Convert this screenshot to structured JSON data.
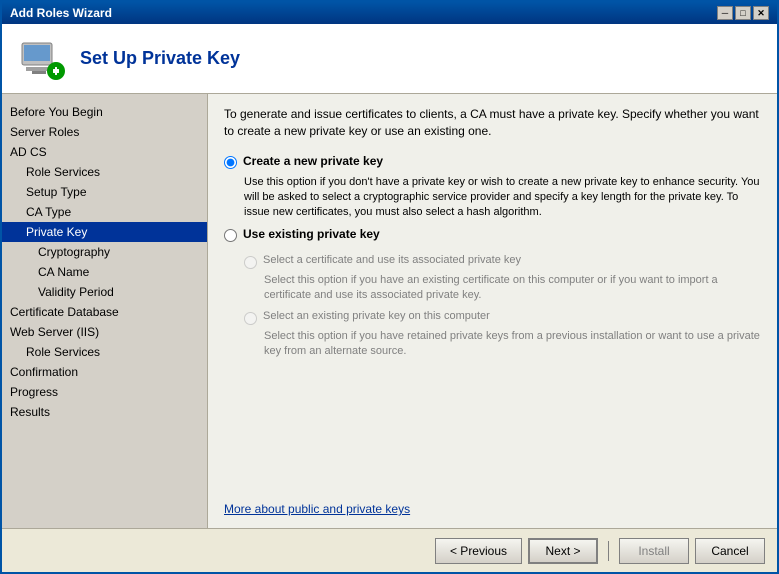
{
  "window": {
    "title": "Add Roles Wizard",
    "close_btn": "✕",
    "minimize_btn": "─",
    "maximize_btn": "□"
  },
  "header": {
    "title": "Set Up Private Key",
    "icon_alt": "wizard-icon"
  },
  "sidebar": {
    "items": [
      {
        "label": "Before You Begin",
        "level": "section",
        "state": "normal"
      },
      {
        "label": "Server Roles",
        "level": "section",
        "state": "normal"
      },
      {
        "label": "AD CS",
        "level": "section",
        "state": "normal"
      },
      {
        "label": "Role Services",
        "level": "sub",
        "state": "normal"
      },
      {
        "label": "Setup Type",
        "level": "sub",
        "state": "normal"
      },
      {
        "label": "CA Type",
        "level": "sub",
        "state": "normal"
      },
      {
        "label": "Private Key",
        "level": "sub",
        "state": "active"
      },
      {
        "label": "Cryptography",
        "level": "sub2",
        "state": "normal"
      },
      {
        "label": "CA Name",
        "level": "sub2",
        "state": "normal"
      },
      {
        "label": "Validity Period",
        "level": "sub2",
        "state": "normal"
      },
      {
        "label": "Certificate Database",
        "level": "section",
        "state": "normal"
      },
      {
        "label": "Web Server (IIS)",
        "level": "section",
        "state": "normal"
      },
      {
        "label": "Role Services",
        "level": "sub",
        "state": "normal"
      },
      {
        "label": "Confirmation",
        "level": "section",
        "state": "normal"
      },
      {
        "label": "Progress",
        "level": "section",
        "state": "normal"
      },
      {
        "label": "Results",
        "level": "section",
        "state": "normal"
      }
    ]
  },
  "content": {
    "description": "To generate and issue certificates to clients, a CA must have a private key. Specify whether you want to create a new private key or use an existing one.",
    "radio1_label": "Create a new private key",
    "radio1_desc": "Use this option if you don't have a private key or wish to create a new private key to enhance security. You will be asked to select a cryptographic service provider and specify a key length for the private key. To issue new certificates, you must also select a hash algorithm.",
    "radio2_label": "Use existing private key",
    "radio2_desc": "",
    "sub_radio1_label": "Select a certificate and use its associated private key",
    "sub_radio1_desc": "Select this option if you have an existing certificate on this computer or if you want to import a certificate and use its associated private key.",
    "sub_radio2_label": "Select an existing private key on this computer",
    "sub_radio2_desc": "Select this option if you have retained private keys from a previous installation or want to use a private key from an alternate source.",
    "help_link": "More about public and private keys"
  },
  "footer": {
    "prev_label": "< Previous",
    "next_label": "Next >",
    "install_label": "Install",
    "cancel_label": "Cancel"
  }
}
